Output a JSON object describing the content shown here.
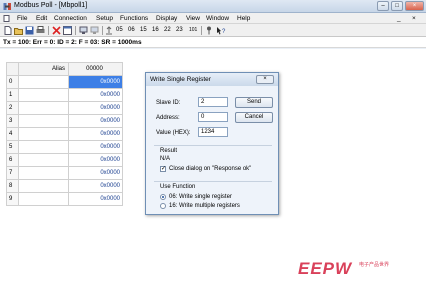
{
  "window": {
    "title": "Modbus Poll - [Mbpoll1]",
    "controls": [
      "–",
      "□",
      "×"
    ]
  },
  "menu": [
    "File",
    "Edit",
    "Connection",
    "Setup",
    "Functions",
    "Display",
    "View",
    "Window",
    "Help"
  ],
  "menu_right_controls": [
    "_",
    "×"
  ],
  "toolbar": {
    "function_codes": [
      "05",
      "06",
      "15",
      "16",
      "22",
      "23",
      "101"
    ]
  },
  "status_line": "Tx = 100: Err = 0: ID = 2: F = 03: SR = 1000ms",
  "grid": {
    "headers": [
      "",
      "Alias",
      "00000"
    ],
    "rows": [
      {
        "idx": "0",
        "value": "0x0000"
      },
      {
        "idx": "1",
        "value": "0x0000"
      },
      {
        "idx": "2",
        "value": "0x0000"
      },
      {
        "idx": "3",
        "value": "0x0000"
      },
      {
        "idx": "4",
        "value": "0x0000"
      },
      {
        "idx": "5",
        "value": "0x0000"
      },
      {
        "idx": "6",
        "value": "0x0000"
      },
      {
        "idx": "7",
        "value": "0x0000"
      },
      {
        "idx": "8",
        "value": "0x0000"
      },
      {
        "idx": "9",
        "value": "0x0000"
      }
    ]
  },
  "dialog": {
    "title": "Write Single Register",
    "close": "×",
    "slave_id_label": "Slave ID:",
    "slave_id": "2",
    "address_label": "Address:",
    "address": "0",
    "value_label": "Value (HEX):",
    "value": "1234",
    "send": "Send",
    "cancel": "Cancel",
    "result_label": "Result",
    "result_value": "N/A",
    "close_on_ok": "Close dialog on \"Response ok\"",
    "use_function_label": "Use Function",
    "fn06": "06: Write single register",
    "fn16": "16: Write multiple registers"
  },
  "watermark": {
    "brand": "EEPW",
    "sub": "电子产品世界"
  },
  "colors": {
    "selection": "#3d7fe6",
    "watermark": "#d9415a"
  }
}
